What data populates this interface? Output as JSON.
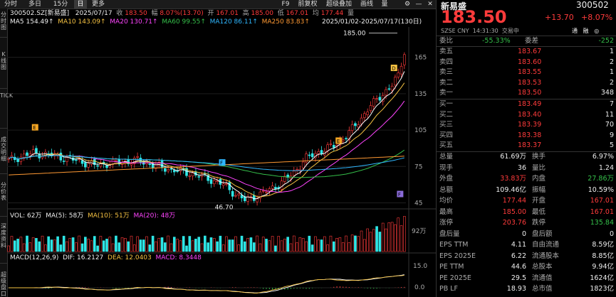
{
  "toolbar": {
    "tabs": [
      "分时",
      "多日",
      "15分",
      "日",
      "更多"
    ],
    "right_items": [
      "F9",
      "前复权",
      "超级叠加",
      "画线",
      "量"
    ]
  },
  "side": {
    "labels": [
      "分时图",
      "K线图",
      "TICK",
      "成交明细",
      "分价表",
      "深度资料",
      "超级盘口"
    ]
  },
  "info": {
    "code": "300502.SZ[新易盛]",
    "date": "2025/07/17",
    "close_label": "收",
    "close": "183.50",
    "change_label": "幅",
    "change": "8.07%(13.70)",
    "open_label": "开",
    "open": "167.01",
    "high_label": "高",
    "high": "185.00",
    "low_label": "低",
    "low": "167.01",
    "amp_label": "均",
    "amp": "177.44",
    "vol_label": "量"
  },
  "ma": {
    "ma5": "MA5 154.49↑",
    "ma10": "MA10 143.09↑",
    "ma20": "MA20 130.71↑",
    "ma60": "MA60 99.55↑",
    "ma120": "MA120 86.11↑",
    "ma250": "MA250 83.83↑",
    "range": "2025/01/02-2025/07/17(130日)"
  },
  "vol_line": {
    "vol": "VOL: 62万",
    "ma5": "MA(5): 58万",
    "ma10": "MA(10): 51万",
    "ma20": "MA(20): 48万"
  },
  "macd_line": {
    "title": "MACD(12,26,9)",
    "dif": "DIF: 16.2127",
    "dea": "DEA: 12.0403",
    "macd": "MACD: 8.3448"
  },
  "axes": {
    "price_ticks": [
      "165",
      "135",
      "105",
      "75",
      "45"
    ],
    "vol_ticks": [
      "92万"
    ],
    "macd_ticks": [
      "15.0",
      "0.0"
    ],
    "high_mark": "185.00",
    "low_mark": "46.70"
  },
  "markers": [
    "E",
    "E",
    "D",
    "F",
    "F"
  ],
  "chart_data": {
    "type": "line",
    "title": "",
    "ylim": [
      40,
      190
    ],
    "series": [
      {
        "name": "MA5",
        "color": "#ffffff"
      },
      {
        "name": "MA10",
        "color": "#f5c242"
      },
      {
        "name": "MA20",
        "color": "#ff44ff"
      },
      {
        "name": "MA60",
        "color": "#35c04a"
      },
      {
        "name": "MA120",
        "color": "#2fb7ff"
      },
      {
        "name": "MA250",
        "color": "#ff9933"
      }
    ]
  },
  "quote": {
    "name": "新易盛",
    "code": "300502",
    "price": "183.50",
    "change": "+13.70",
    "pct": "+8.07%",
    "market": "SZSE CNY",
    "time": "14:31:30",
    "status": "交易中",
    "tags": [
      "通",
      "融",
      "◎"
    ]
  },
  "orderbook": {
    "wb_label": "委比",
    "wb": "-55.33%",
    "wc_label": "委差",
    "wc": "-252",
    "sell": [
      {
        "label": "卖五",
        "price": "183.67",
        "vol": "1"
      },
      {
        "label": "卖四",
        "price": "183.60",
        "vol": "2"
      },
      {
        "label": "卖三",
        "price": "183.55",
        "vol": "1"
      },
      {
        "label": "卖二",
        "price": "183.53",
        "vol": "2"
      },
      {
        "label": "卖一",
        "price": "183.50",
        "vol": "348"
      }
    ],
    "buy": [
      {
        "label": "买一",
        "price": "183.49",
        "vol": "7"
      },
      {
        "label": "买二",
        "price": "183.40",
        "vol": "11"
      },
      {
        "label": "买三",
        "price": "183.39",
        "vol": "70"
      },
      {
        "label": "买四",
        "price": "183.38",
        "vol": "9"
      },
      {
        "label": "买五",
        "price": "183.37",
        "vol": "5"
      }
    ]
  },
  "stats": [
    {
      "l1": "总量",
      "v1": "61.69万",
      "c1": "white",
      "l2": "换手",
      "v2": "6.97%",
      "c2": "white"
    },
    {
      "l1": "现手",
      "v1": "36",
      "c1": "white",
      "l2": "量比",
      "v2": "1.24",
      "c2": "white"
    },
    {
      "l1": "外盘",
      "v1": "33.83万",
      "c1": "red",
      "l2": "内盘",
      "v2": "27.86万",
      "c2": "green"
    },
    {
      "l1": "总额",
      "v1": "109.46亿",
      "c1": "white",
      "l2": "振幅",
      "v2": "10.59%",
      "c2": "white"
    },
    {
      "l1": "均价",
      "v1": "177.44",
      "c1": "red",
      "l2": "开盘",
      "v2": "167.01",
      "c2": "red"
    },
    {
      "l1": "最高",
      "v1": "185.00",
      "c1": "red",
      "l2": "最低",
      "v2": "167.01",
      "c2": "red"
    },
    {
      "l1": "涨停",
      "v1": "203.76",
      "c1": "red",
      "l2": "跌停",
      "v2": "135.84",
      "c2": "green"
    },
    {
      "l1": "盘后量",
      "v1": "0",
      "c1": "white",
      "l2": "盘后额",
      "v2": "0",
      "c2": "white"
    },
    {
      "l1": "EPS TTM",
      "v1": "4.11",
      "c1": "white",
      "l2": "自由流通",
      "v2": "8.59亿",
      "c2": "white"
    },
    {
      "l1": "EPS 2025E",
      "v1": "6.22",
      "c1": "white",
      "l2": "流通股本",
      "v2": "8.85亿",
      "c2": "white"
    },
    {
      "l1": "PE TTM",
      "v1": "44.6",
      "c1": "white",
      "l2": "总股本",
      "v2": "9.94亿",
      "c2": "white"
    },
    {
      "l1": "PE 2025E",
      "v1": "29.5",
      "c1": "white",
      "l2": "流通值",
      "v2": "1624亿",
      "c2": "white"
    },
    {
      "l1": "PB LF",
      "v1": "18.93",
      "c1": "white",
      "l2": "总市值",
      "v2": "1823亿",
      "c2": "white"
    }
  ]
}
